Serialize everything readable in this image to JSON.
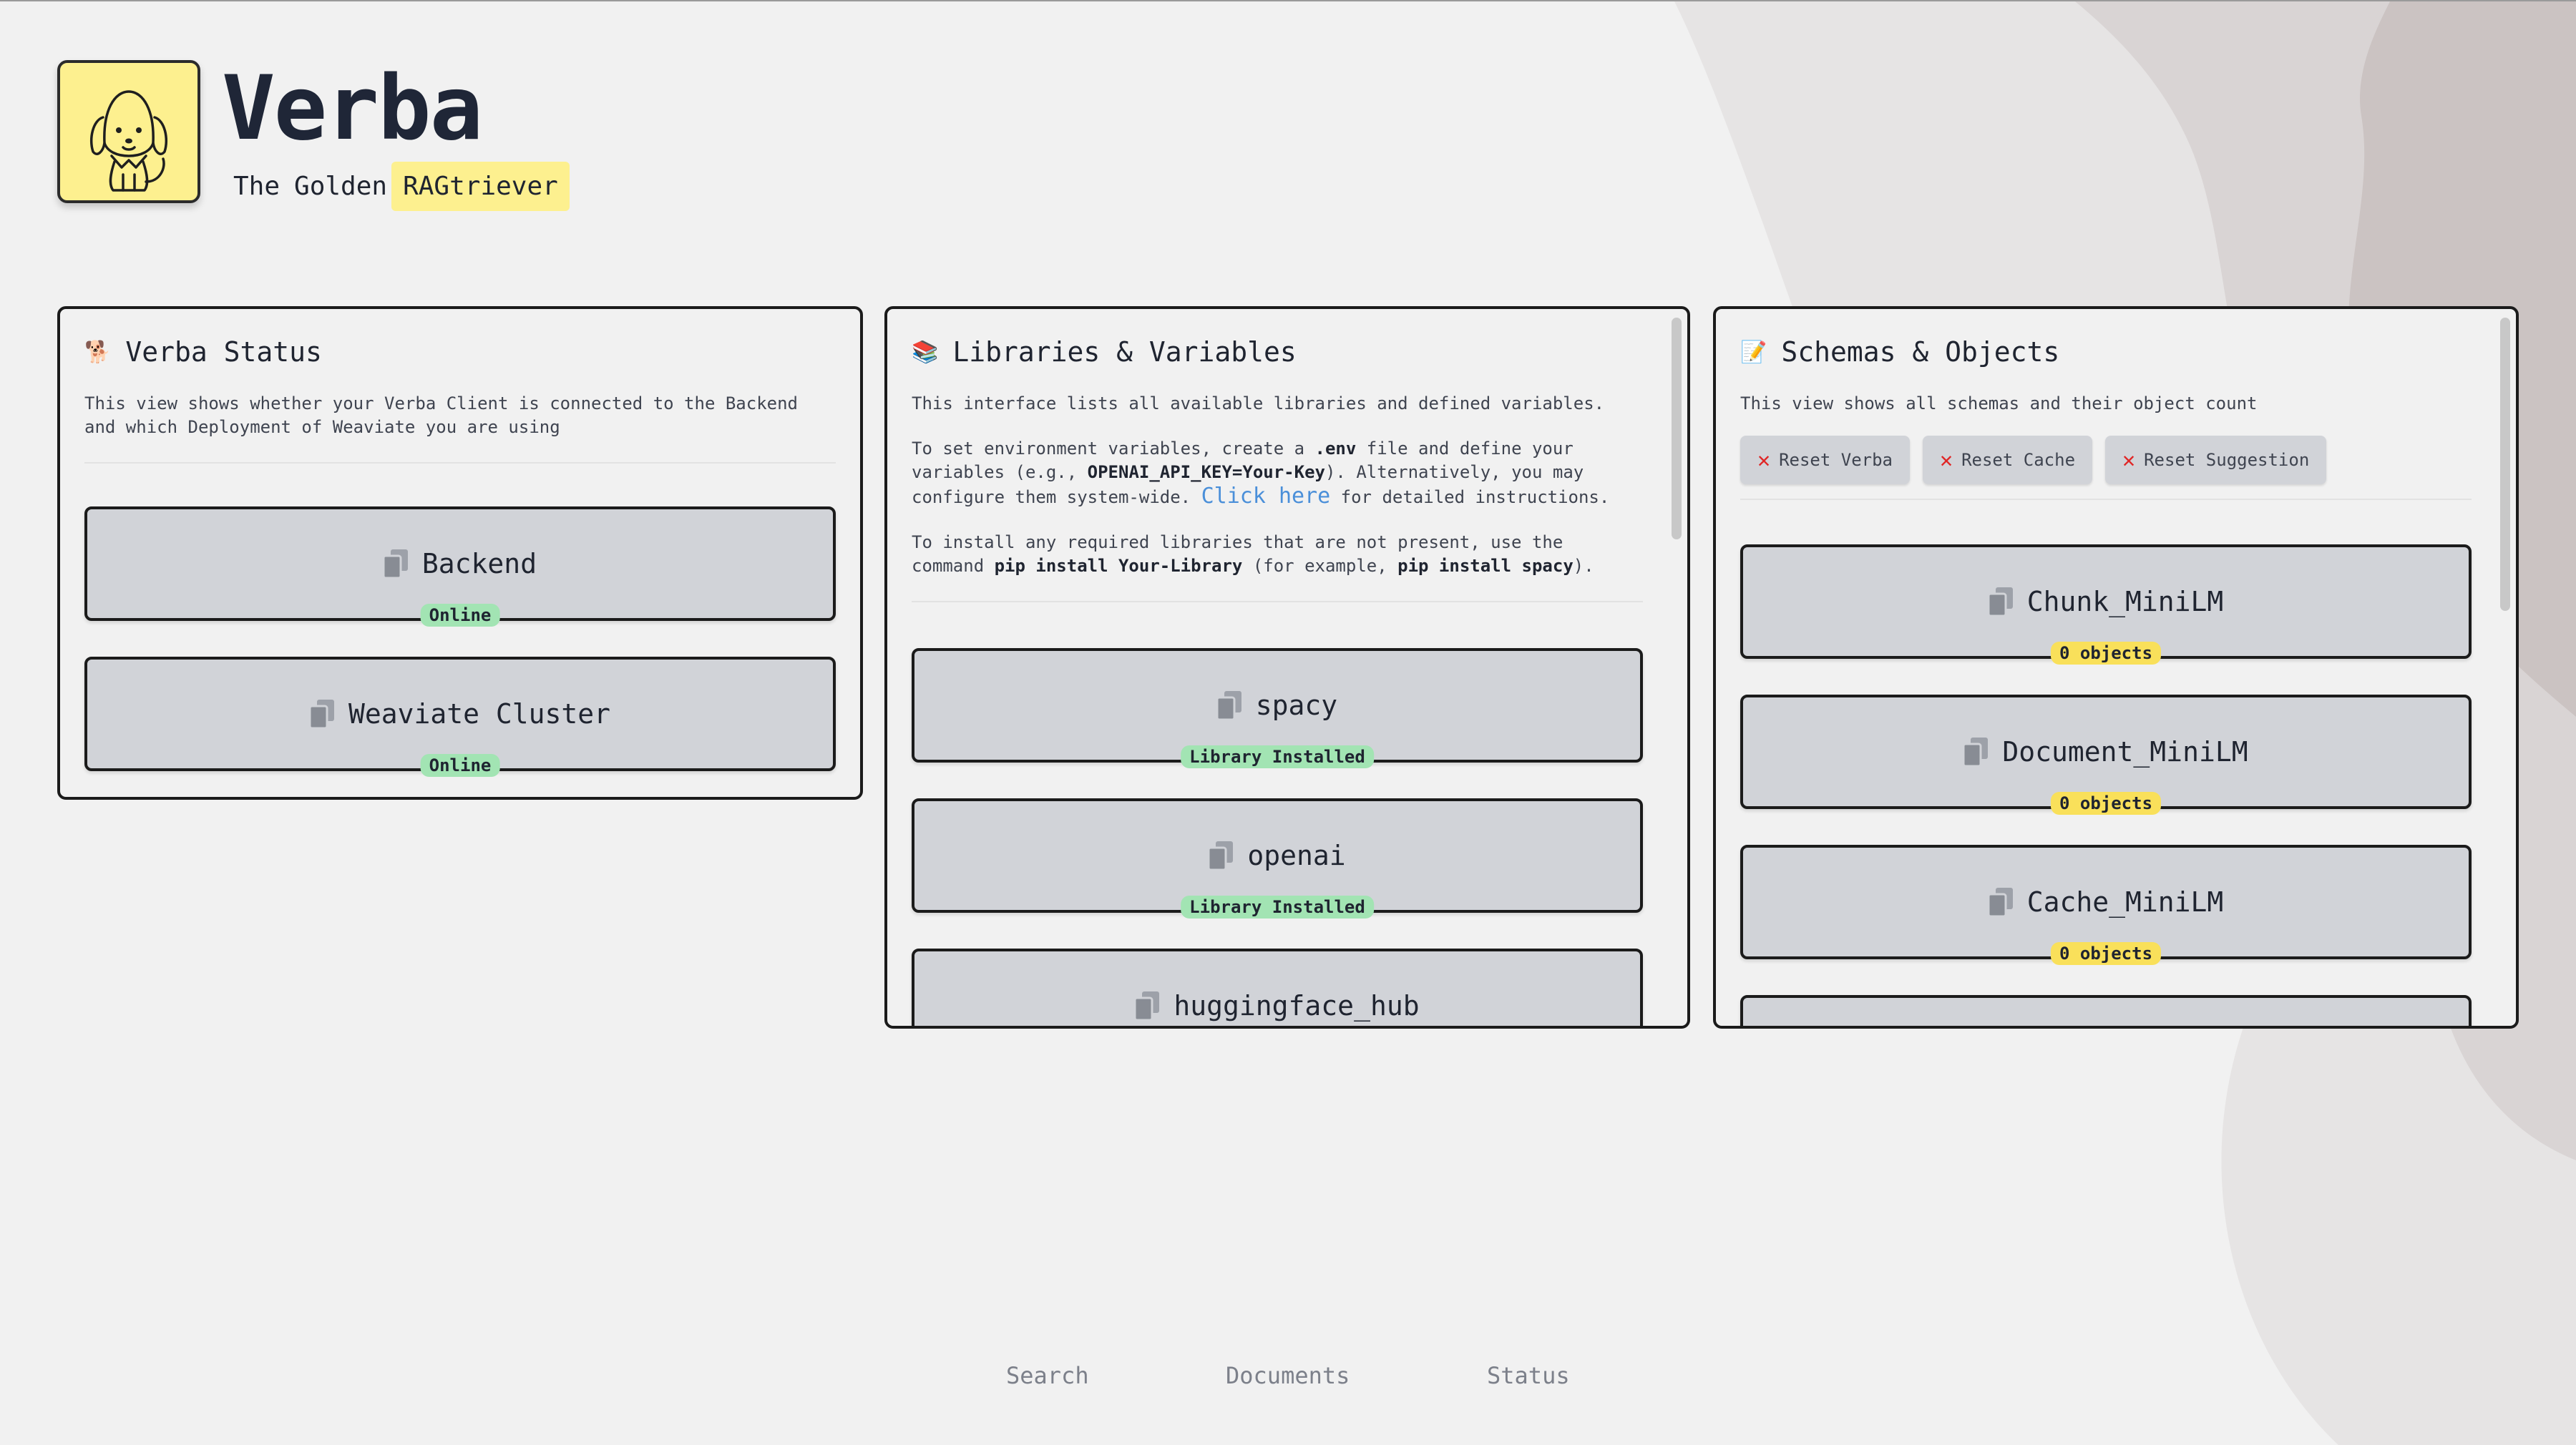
{
  "app": {
    "title": "Verba",
    "subtitle_1": "The",
    "subtitle_2": "Golden",
    "subtitle_highlight": "RAGtriever"
  },
  "status_panel": {
    "emoji": "🐕",
    "title": "Verba Status",
    "description": "This view shows whether your Verba Client is connected to the Backend and which Deployment of Weaviate you are using",
    "cards": [
      {
        "name": "Backend",
        "badge": "Online"
      },
      {
        "name": "Weaviate Cluster",
        "badge": "Online"
      }
    ]
  },
  "libraries_panel": {
    "emoji": "📚",
    "title": "Libraries & Variables",
    "p1": "This interface lists all available libraries and defined variables.",
    "p2_a": "To set environment variables, create a ",
    "p2_env": ".env",
    "p2_b": " file and define your variables (e.g., ",
    "p2_key": "OPENAI_API_KEY=Your-Key",
    "p2_c": "). Alternatively, you may configure them system-wide. ",
    "p2_link": "Click here",
    "p2_d": " for detailed instructions.",
    "p3_a": "To install any required libraries that are not present, use the command ",
    "p3_cmd1": "pip install Your-Library",
    "p3_b": " (for example, ",
    "p3_cmd2": "pip install spacy",
    "p3_c": ").",
    "cards": [
      {
        "name": "spacy",
        "badge": "Library Installed"
      },
      {
        "name": "openai",
        "badge": "Library Installed"
      },
      {
        "name": "huggingface_hub",
        "badge": ""
      }
    ]
  },
  "schemas_panel": {
    "emoji": "📝",
    "title": "Schemas & Objects",
    "description": "This view shows all schemas and their object count",
    "buttons": [
      "Reset Verba",
      "Reset Cache",
      "Reset Suggestion"
    ],
    "cards": [
      {
        "name": "Chunk_MiniLM",
        "badge": "0 objects"
      },
      {
        "name": "Document_MiniLM",
        "badge": "0 objects"
      },
      {
        "name": "Cache_MiniLM",
        "badge": "0 objects"
      }
    ]
  },
  "nav": {
    "items": [
      "Search",
      "Documents",
      "Status"
    ]
  },
  "colors": {
    "background": "#f1f1f1",
    "accent_yellow": "#fdf08f",
    "card": "#d1d3d8",
    "badge_green": "#a2e4b3",
    "badge_yellow": "#f9e05a",
    "reset_x": "#e02626",
    "link": "#4a8fd9"
  }
}
